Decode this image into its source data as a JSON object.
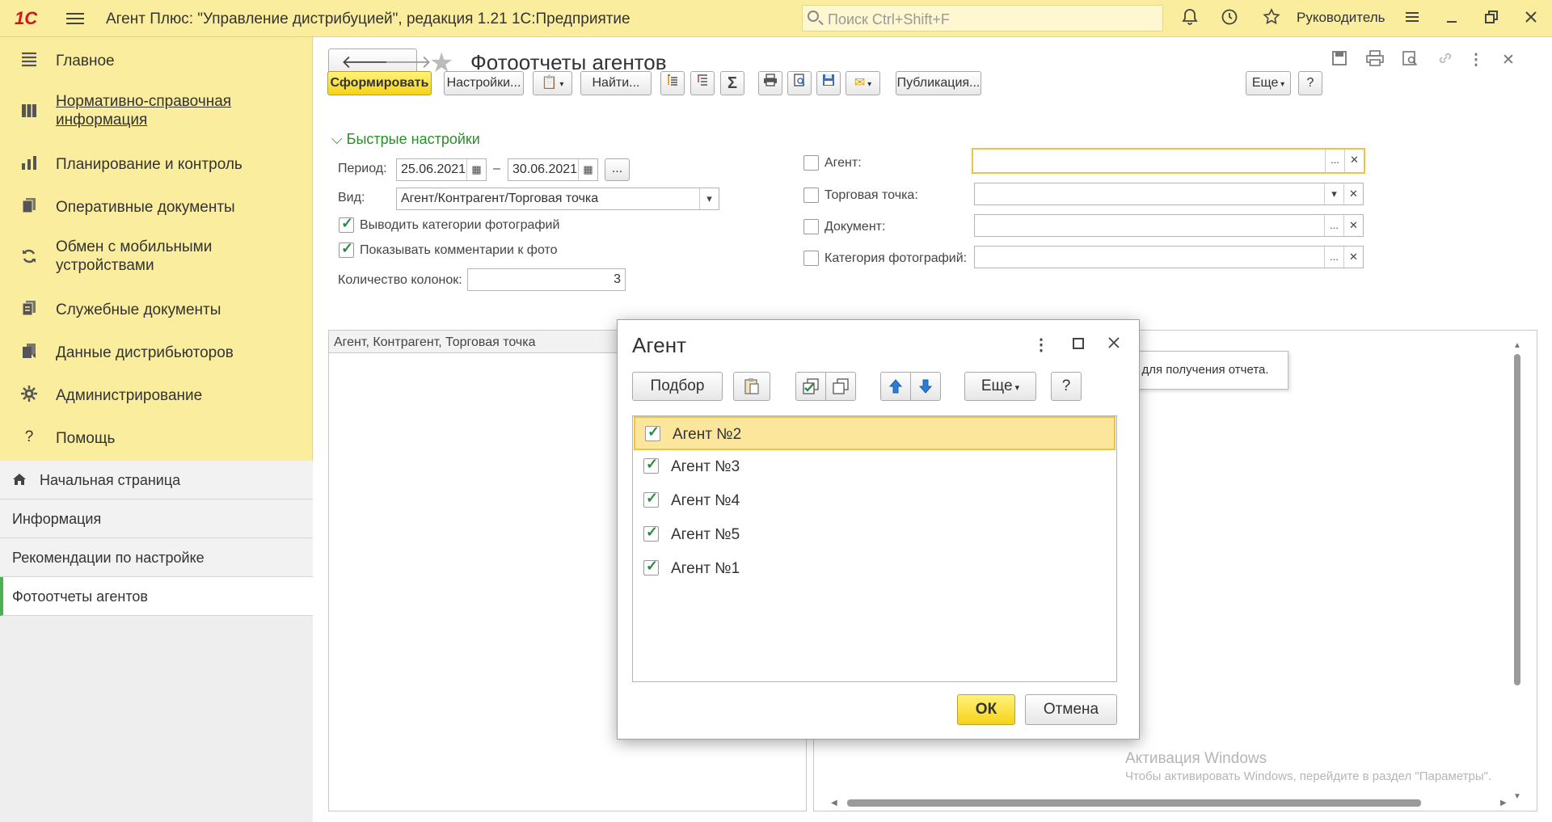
{
  "app": {
    "logo": "1С",
    "title": "Агент Плюс: \"Управление дистрибуцией\", редакция 1.21 1С:Предприятие",
    "search_placeholder": "Поиск Ctrl+Shift+F",
    "user": "Руководитель"
  },
  "sidebar": {
    "sections": [
      {
        "label": "Главное",
        "icon": "menu-lines-icon"
      },
      {
        "label": "Нормативно-справочная информация",
        "icon": "reference-book-icon"
      },
      {
        "label": "Планирование и контроль",
        "icon": "bar-chart-icon"
      },
      {
        "label": "Оперативные документы",
        "icon": "documents-icon"
      },
      {
        "label": "Обмен с мобильными устройствами",
        "icon": "sync-icon"
      },
      {
        "label": "Служебные документы",
        "icon": "service-docs-icon"
      },
      {
        "label": "Данные дистрибьюторов",
        "icon": "distributor-data-icon"
      },
      {
        "label": "Администрирование",
        "icon": "gear-icon"
      },
      {
        "label": "Помощь",
        "icon": "help-icon"
      }
    ],
    "open_windows": [
      {
        "label": "Начальная страница"
      },
      {
        "label": "Информация"
      },
      {
        "label": "Рекомендации по настройке"
      },
      {
        "label": "Фотоотчеты агентов"
      }
    ]
  },
  "form": {
    "title": "Фотоотчеты агентов",
    "toolbar": {
      "generate": "Сформировать",
      "settings": "Настройки...",
      "find": "Найти...",
      "publish": "Публикация...",
      "more": "Еще",
      "help": "?"
    },
    "quick_settings": "Быстрые настройки",
    "period_label": "Период:",
    "period_from": "25.06.2021",
    "period_dash": "–",
    "period_to": "30.06.2021",
    "ellipsis": "...",
    "view_label": "Вид:",
    "view_value": "Агент/Контрагент/Торговая точка",
    "show_photo_categories": "Выводить категории фотографий",
    "show_photo_comments": "Показывать комментарии к фото",
    "columns_label": "Количество колонок:",
    "columns_value": "3",
    "filters": [
      {
        "label": "Агент:",
        "checked": false
      },
      {
        "label": "Торговая точка:",
        "checked": false
      },
      {
        "label": "Документ:",
        "checked": false
      },
      {
        "label": "Категория фотографий:",
        "checked": false
      }
    ],
    "report_header": "Агент, Контрагент, Торговая точка",
    "report_hint": "\" для получения отчета."
  },
  "dialog": {
    "title": "Агент",
    "pick": "Подбор",
    "more": "Еще",
    "help": "?",
    "items": [
      {
        "label": "Агент №2",
        "checked": true,
        "selected": true
      },
      {
        "label": "Агент №3",
        "checked": true,
        "selected": false
      },
      {
        "label": "Агент №4",
        "checked": true,
        "selected": false
      },
      {
        "label": "Агент №5",
        "checked": true,
        "selected": false
      },
      {
        "label": "Агент №1",
        "checked": true,
        "selected": false
      }
    ],
    "ok": "ОК",
    "cancel": "Отмена"
  },
  "watermark": {
    "line1": "Активация Windows",
    "line2": "Чтобы активировать Windows, перейдите в раздел \"Параметры\"."
  },
  "colors": {
    "accent_yellow": "#fbed9e",
    "button_yellow": "#f6d318",
    "check_green": "#2b8a3e",
    "selection": "#fbe69b"
  }
}
